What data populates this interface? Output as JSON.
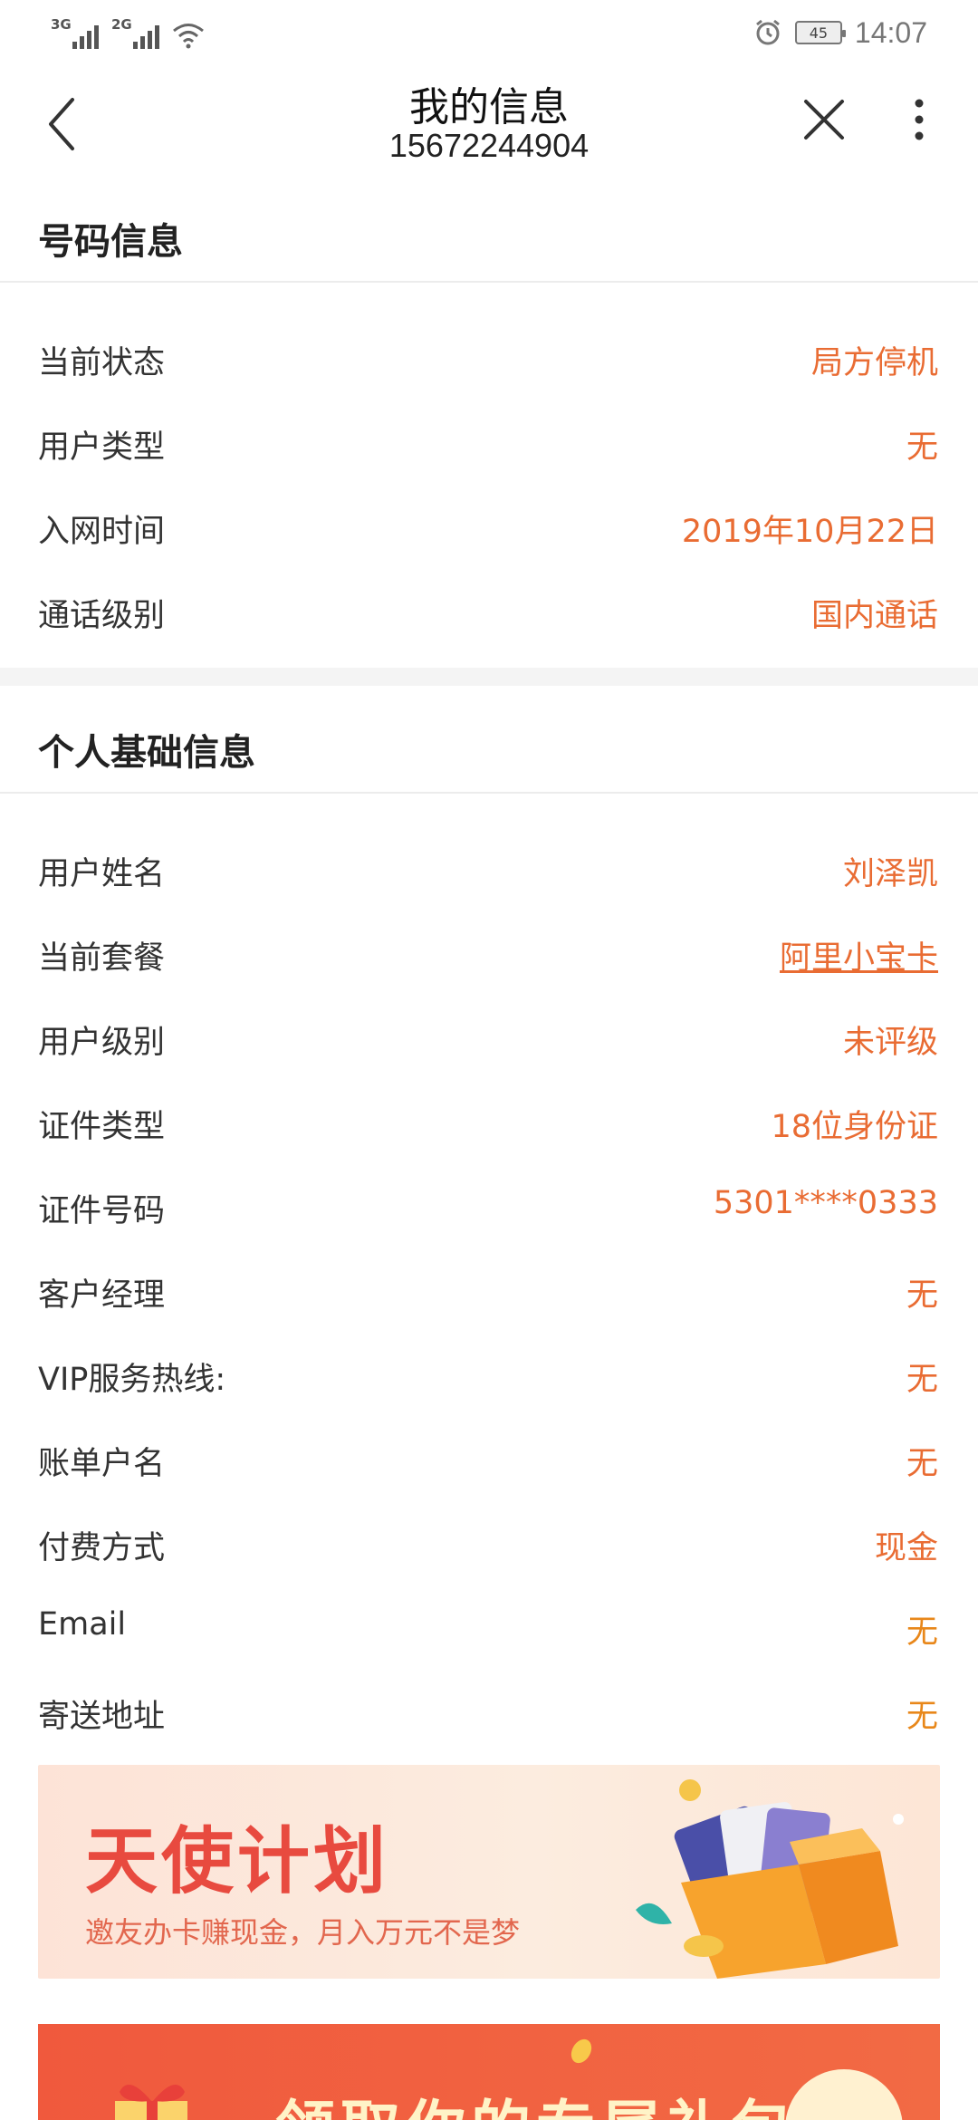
{
  "status_bar": {
    "network_1": "3G",
    "network_2": "2G",
    "battery": "45",
    "time": "14:07",
    "icons": [
      "signal-icon",
      "wifi-icon",
      "alarm-icon",
      "battery-icon"
    ]
  },
  "nav": {
    "title": "我的信息",
    "subtitle": "15672244904"
  },
  "number_info": {
    "heading": "号码信息",
    "rows": [
      {
        "label": "当前状态",
        "value": "局方停机"
      },
      {
        "label": "用户类型",
        "value": "无"
      },
      {
        "label": "入网时间",
        "value": "2019年10月22日"
      },
      {
        "label": "通话级别",
        "value": "国内通话"
      }
    ]
  },
  "personal_info": {
    "heading": "个人基础信息",
    "rows": [
      {
        "label": "用户姓名",
        "value": "刘泽凯"
      },
      {
        "label": "当前套餐",
        "value": "阿里小宝卡"
      },
      {
        "label": "用户级别",
        "value": "未评级"
      },
      {
        "label": "证件类型",
        "value": "18位身份证"
      },
      {
        "label": "证件号码",
        "value": "5301****0333"
      },
      {
        "label": "客户经理",
        "value": "无"
      },
      {
        "label": "VIP服务热线:",
        "value": "无"
      },
      {
        "label": "账单户名",
        "value": "无"
      },
      {
        "label": "付费方式",
        "value": "现金"
      },
      {
        "label": "Email",
        "value": "无"
      },
      {
        "label": "寄送地址",
        "value": "无"
      }
    ]
  },
  "banners": {
    "angel_title": "天使计划",
    "angel_subtitle": "邀友办卡赚现金，月入万元不是梦",
    "gift_title": "领取你的专属礼包"
  },
  "colors": {
    "value_orange": "#e96c33",
    "value_gold": "#e8871a",
    "banner_red": "#f0593d"
  }
}
